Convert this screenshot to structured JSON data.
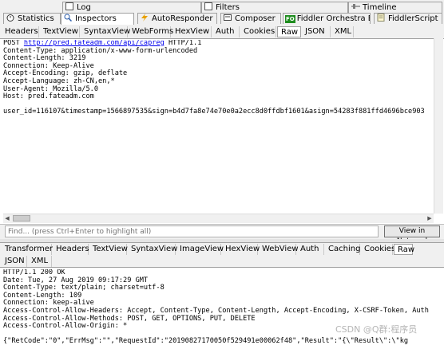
{
  "top_tabs": {
    "log": "Log",
    "filters": "Filters",
    "timeline": "Timeline",
    "statistics": "Statistics",
    "inspectors": "Inspectors",
    "autoresponder": "AutoResponder",
    "composer": "Composer",
    "orchestra": "Fiddler Orchestra Beta",
    "orchestra_badge": "FO",
    "fiddlerscript": "FiddlerScript"
  },
  "request_tabs": [
    "Headers",
    "TextView",
    "SyntaxView",
    "WebForms",
    "HexView",
    "Auth",
    "Cookies",
    "Raw",
    "JSON",
    "XML"
  ],
  "request": {
    "method": "POST",
    "url": "http://pred.fateadm.com/api/capreg",
    "protocol": "HTTP/1.1",
    "headers": [
      "Content-Type: application/x-www-form-urlencoded",
      "Content-Length: 3219",
      "Connection: Keep-Alive",
      "Accept-Encoding: gzip, deflate",
      "Accept-Language: zh-CN,en,*",
      "User-Agent: Mozilla/5.0",
      "Host: pred.fateadm.com"
    ],
    "body": "user_id=116107&timestamp=1566897535&sign=b4d7fa8e74e70e0a2ecc8d0ffdbf1601&asign=54283f881ffd4696bce903"
  },
  "find_bar": {
    "placeholder": "Find... (press Ctrl+Enter to highlight all)",
    "button": "View in Notepad"
  },
  "response_tabs_row1": [
    "Transformer",
    "Headers",
    "TextView",
    "SyntaxView",
    "ImageView",
    "HexView",
    "WebView",
    "Auth",
    "Caching",
    "Cookies",
    "Raw"
  ],
  "response_tabs_row2": [
    "JSON",
    "XML"
  ],
  "response": {
    "lines": [
      "HTTP/1.1 200 OK",
      "Date: Tue, 27 Aug 2019 09:17:29 GMT",
      "Content-Type: text/plain; charset=utf-8",
      "Content-Length: 109",
      "Connection: keep-alive",
      "Access-Control-Allow-Headers: Accept, Content-Type, Content-Length, Accept-Encoding, X-CSRF-Token, Auth",
      "Access-Control-Allow-Methods: POST, GET, OPTIONS, PUT, DELETE",
      "Access-Control-Allow-Origin: *"
    ],
    "body": "{\"RetCode\":\"0\",\"ErrMsg\":\"\",\"RequestId\":\"20190827170050f529491e00062f48\",\"Result\":\"{\\\"Result\\\":\\\"kg"
  },
  "watermark": "CSDN @Q群:程序员",
  "colors": {
    "link": "#0000ee",
    "orchestra_badge": "#1e8c1e",
    "tab_bg": "#f0f0f0",
    "border": "#a0a0a0"
  }
}
